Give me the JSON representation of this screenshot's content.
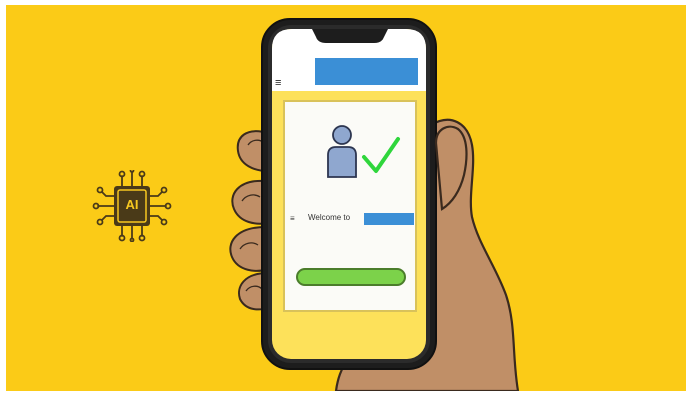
{
  "illustration": {
    "background_color": "#fbcb17",
    "phone_header": {
      "menu_icon": "hamburger-icon",
      "title_placeholder_color": "#3b8fd6"
    },
    "card": {
      "user_icon": "user-icon",
      "check_icon": "checkmark-icon",
      "welcome_text": "Welcome to",
      "name_placeholder_color": "#3b8fd6",
      "button_color": "#7cd24a"
    },
    "ai_badge": {
      "label": "AI",
      "icon": "ai-chip-icon"
    }
  }
}
